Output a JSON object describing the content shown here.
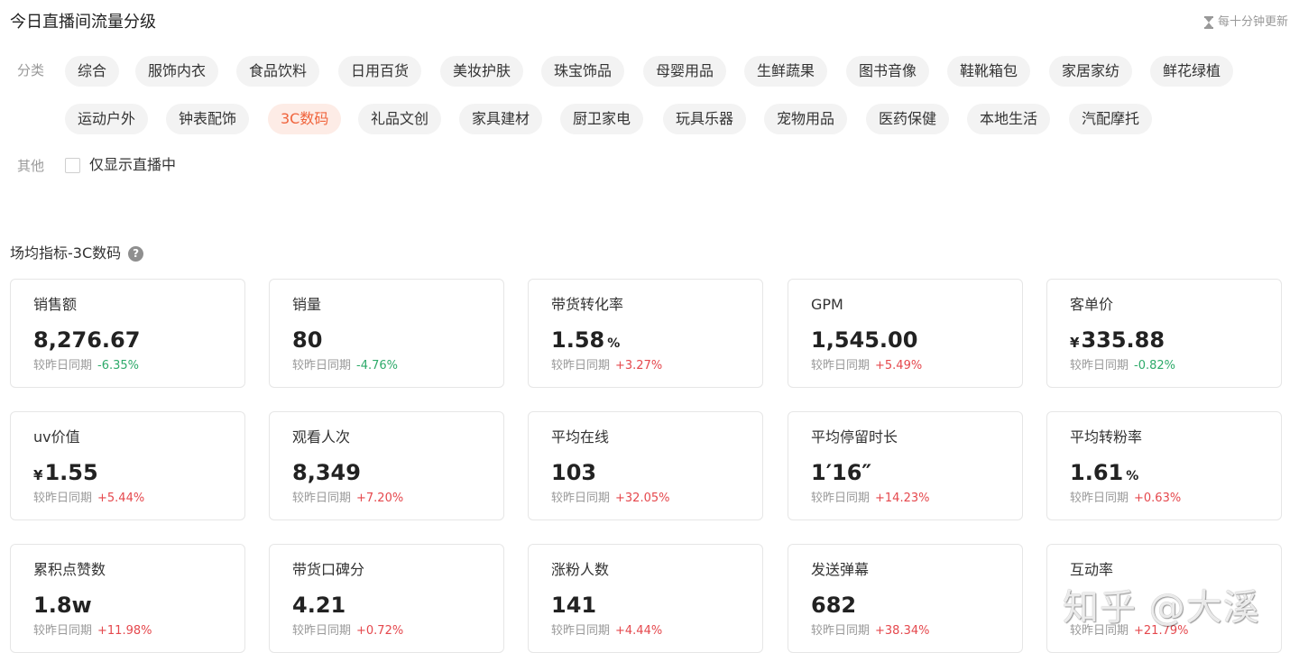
{
  "header": {
    "title": "今日直播间流量分级",
    "update_note": "每十分钟更新",
    "update_icon": "hourglass-icon"
  },
  "filters": {
    "category_label": "分类",
    "categories_row1": [
      "综合",
      "服饰内衣",
      "食品饮料",
      "日用百货",
      "美妆护肤",
      "珠宝饰品",
      "母婴用品",
      "生鲜蔬果",
      "图书音像",
      "鞋靴箱包",
      "家居家纺",
      "鲜花绿植"
    ],
    "categories_row2": [
      "运动户外",
      "钟表配饰",
      "3C数码",
      "礼品文创",
      "家具建材",
      "厨卫家电",
      "玩具乐器",
      "宠物用品",
      "医药保健",
      "本地生活",
      "汽配摩托"
    ],
    "active_category": "3C数码",
    "other_label": "其他",
    "live_only_label": "仅显示直播中",
    "live_only_checked": false
  },
  "section": {
    "title": "场均指标-3C数码",
    "help_icon": "help-icon"
  },
  "compare_label": "较昨日同期",
  "colors": {
    "active_chip_bg": "#fdece6",
    "active_chip_text": "#f0643c",
    "delta_up": "#e5484d",
    "delta_down": "#2eaa6a"
  },
  "metrics": [
    {
      "label": "销售额",
      "prefix": "",
      "value": "8,276.67",
      "suffix": "",
      "delta": "-6.35%",
      "trend": "down"
    },
    {
      "label": "销量",
      "prefix": "",
      "value": "80",
      "suffix": "",
      "delta": "-4.76%",
      "trend": "down"
    },
    {
      "label": "带货转化率",
      "prefix": "",
      "value": "1.58",
      "suffix": "%",
      "delta": "+3.27%",
      "trend": "up"
    },
    {
      "label": "GPM",
      "prefix": "",
      "value": "1,545.00",
      "suffix": "",
      "delta": "+5.49%",
      "trend": "up"
    },
    {
      "label": "客单价",
      "prefix": "¥",
      "value": "335.88",
      "suffix": "",
      "delta": "-0.82%",
      "trend": "down"
    },
    {
      "label": "uv价值",
      "prefix": "¥",
      "value": "1.55",
      "suffix": "",
      "delta": "+5.44%",
      "trend": "up"
    },
    {
      "label": "观看人次",
      "prefix": "",
      "value": "8,349",
      "suffix": "",
      "delta": "+7.20%",
      "trend": "up"
    },
    {
      "label": "平均在线",
      "prefix": "",
      "value": "103",
      "suffix": "",
      "delta": "+32.05%",
      "trend": "up"
    },
    {
      "label": "平均停留时长",
      "prefix": "",
      "value": "1′16″",
      "suffix": "",
      "delta": "+14.23%",
      "trend": "up"
    },
    {
      "label": "平均转粉率",
      "prefix": "",
      "value": "1.61",
      "suffix": "%",
      "delta": "+0.63%",
      "trend": "up"
    },
    {
      "label": "累积点赞数",
      "prefix": "",
      "value": "1.8w",
      "suffix": "",
      "delta": "+11.98%",
      "trend": "up"
    },
    {
      "label": "带货口碑分",
      "prefix": "",
      "value": "4.21",
      "suffix": "",
      "delta": "+0.72%",
      "trend": "up"
    },
    {
      "label": "涨粉人数",
      "prefix": "",
      "value": "141",
      "suffix": "",
      "delta": "+4.44%",
      "trend": "up"
    },
    {
      "label": "发送弹幕",
      "prefix": "",
      "value": "682",
      "suffix": "",
      "delta": "+38.34%",
      "trend": "up"
    },
    {
      "label": "互动率",
      "prefix": "",
      "value": "",
      "suffix": "",
      "delta": "+21.79%",
      "trend": "up"
    }
  ],
  "watermark": "知乎 @大溪"
}
